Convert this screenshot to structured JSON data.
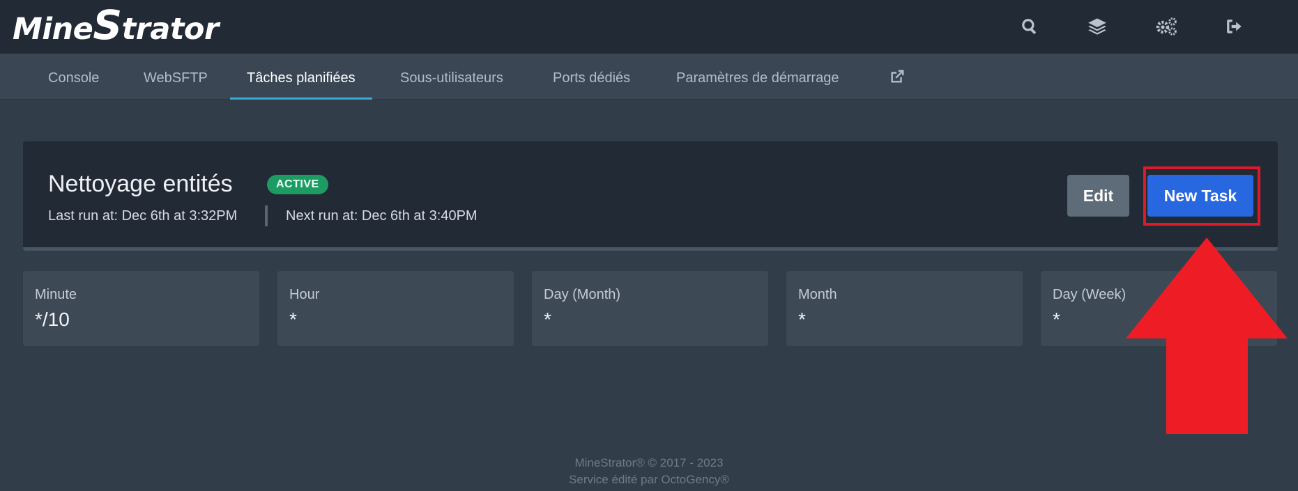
{
  "brand": {
    "logo_text_before": "Mine",
    "logo_s": "S",
    "logo_text_after": "trator"
  },
  "top_icons": [
    "search-icon",
    "layers-icon",
    "cogs-icon",
    "sign-out-icon"
  ],
  "tabs": [
    {
      "label": "Console",
      "active": false
    },
    {
      "label": "WebSFTP",
      "active": false
    },
    {
      "label": "Tâches planifiées",
      "active": true
    },
    {
      "label": "Sous-utilisateurs",
      "active": false
    },
    {
      "label": "Ports dédiés",
      "active": false
    },
    {
      "label": "Paramètres de démarrage",
      "active": false
    }
  ],
  "task": {
    "title": "Nettoyage entités",
    "status": "ACTIVE",
    "last_run": "Last run at: Dec 6th at 3:32PM",
    "next_run": "Next run at: Dec 6th at 3:40PM",
    "edit_label": "Edit",
    "new_task_label": "New Task"
  },
  "schedule": [
    {
      "label": "Minute",
      "value": "*/10"
    },
    {
      "label": "Hour",
      "value": "*"
    },
    {
      "label": "Day (Month)",
      "value": "*"
    },
    {
      "label": "Month",
      "value": "*"
    },
    {
      "label": "Day (Week)",
      "value": "*"
    }
  ],
  "footer": {
    "line1": "MineStrator® © 2017 - 2023",
    "line2": "Service édité par OctoGency®"
  },
  "colors": {
    "accent": "#3da9d6",
    "active_badge": "#1c9b63",
    "primary_button": "#2767e0",
    "annotation_red": "#e0192a"
  }
}
